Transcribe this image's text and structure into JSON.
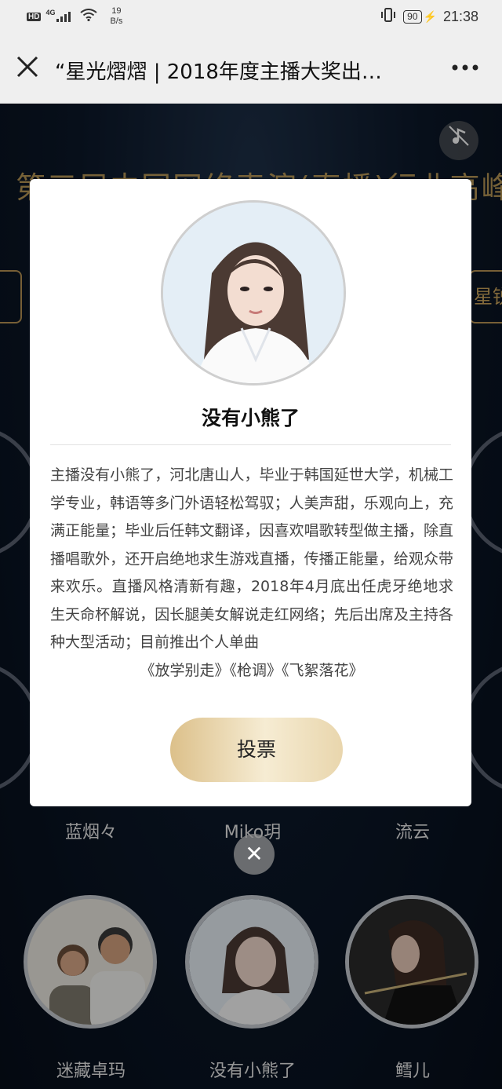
{
  "status_bar": {
    "badge": "HD",
    "network": "4G",
    "speed_value": "19",
    "speed_unit": "B/s",
    "battery": "90",
    "time": "21:38"
  },
  "nav": {
    "title": "“星光熠熠 | 2018年度主播大奖出…",
    "close_icon": "close-icon",
    "more_icon": "more-icon"
  },
  "background": {
    "banner": "第三届中国网络表演(直播)行业高峰论坛",
    "right_tab": "星锐",
    "names_row1": [
      "蓝烟々",
      "Miko玥",
      "流云"
    ],
    "names_row2": [
      "迷藏卓玛",
      "没有小熊了",
      "鳕儿"
    ]
  },
  "modal": {
    "name": "没有小熊了",
    "bio": "主播没有小熊了，河北唐山人，毕业于韩国延世大学，机械工学专业，韩语等多门外语轻松驾驭；人美声甜，乐观向上，充满正能量；毕业后任韩文翻译，因喜欢唱歌转型做主播，除直播唱歌外，还开启绝地求生游戏直播，传播正能量，给观众带来欢乐。直播风格清新有趣，2018年4月底出任虎牙绝地求生天命杯解说，因长腿美女解说走红网络；先后出席及主持各种大型活动；目前推出个人单曲",
    "bio_last": "《放学别走》《枪调》《飞絮落花》",
    "vote_label": "投票",
    "close_label": "✕"
  },
  "colors": {
    "gold_start": "#dcc08a",
    "gold_end": "#f6ecd3",
    "page_bg": "#0b1526"
  }
}
